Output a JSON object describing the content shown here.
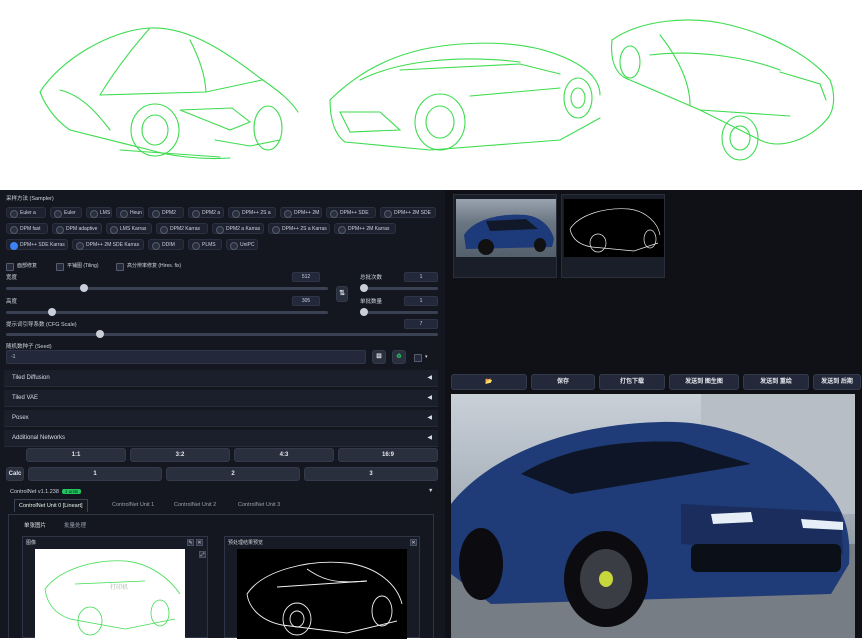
{
  "sampler": {
    "label": "采样方法 (Sampler)",
    "options": [
      "Euler a",
      "Euler",
      "LMS",
      "Heun",
      "DPM2",
      "DPM2 a",
      "DPM++ 2S a",
      "DPM++ 2M",
      "DPM++ SDE",
      "DPM++ 2M SDE",
      "DPM fast",
      "DPM adaptive",
      "LMS Karras",
      "DPM2 Karras",
      "DPM2 a Karras",
      "DPM++ 2S a Karras",
      "DPM++ 2M Karras",
      "DPM++ SDE Karras",
      "DPM++ 2M SDE Karras",
      "DDIM",
      "PLMS",
      "UniPC"
    ],
    "selected": "DPM++ SDE Karras"
  },
  "checkboxes": {
    "face_restore": "面部修复",
    "tiling": "平铺图 (Tiling)",
    "hires": "高分辨率修复 (Hires. fix)"
  },
  "width": {
    "label": "宽度",
    "value": "512"
  },
  "height": {
    "label": "高度",
    "value": "305"
  },
  "swap_icon": "⇅",
  "batch_count": {
    "label": "总批次数",
    "value": "1"
  },
  "batch_size": {
    "label": "单批数量",
    "value": "1"
  },
  "cfg": {
    "label": "提示词引导系数 (CFG Scale)",
    "value": "7"
  },
  "seed": {
    "label": "随机数种子 (Seed)",
    "value": "-1",
    "dice_icon": "⚄",
    "recycle_icon": "♻"
  },
  "accordions": [
    "Tiled Diffusion",
    "Tiled VAE",
    "Posex",
    "Additional Networks"
  ],
  "ratio_buttons": [
    "1:1",
    "3:2",
    "4:3",
    "16:9"
  ],
  "calc": "Calc",
  "scale_buttons": [
    "1",
    "2",
    "3"
  ],
  "controlnet": {
    "title": "ControlNet v1.1.238",
    "badge": "1 units",
    "units": [
      "ControlNet Unit 0 [Lineart]",
      "ControlNet Unit 1",
      "ControlNet Unit 2",
      "ControlNet Unit 3"
    ],
    "subtabs": [
      "单张图片",
      "批量处理"
    ],
    "image_label": "图像",
    "preview_label": "预处理结果预览",
    "watermark": "打印机"
  },
  "actions": [
    "📂",
    "保存",
    "打包下载",
    "发送到 图生图",
    "发送到 重绘",
    "发送到 后期"
  ],
  "colors": {
    "line": "#2ecc40",
    "accent": "#22c55e",
    "bg": "#0f1117"
  }
}
